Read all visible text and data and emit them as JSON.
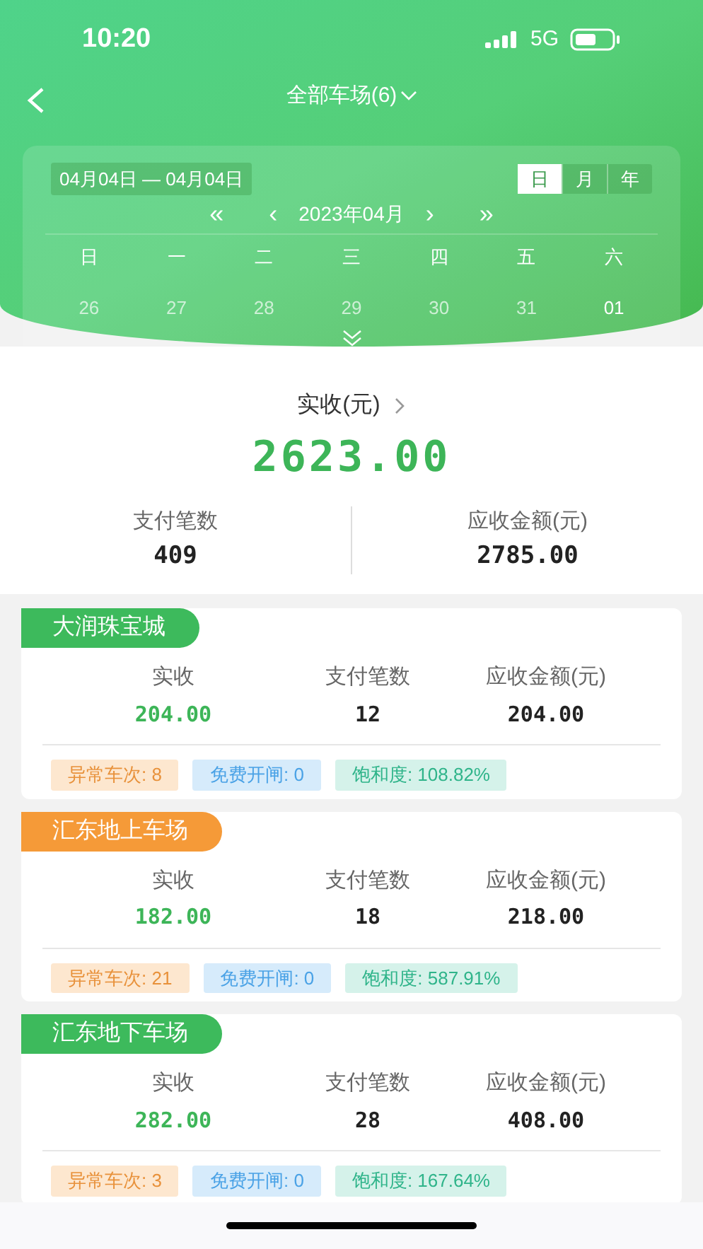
{
  "status_bar": {
    "time": "10:20",
    "network": "5G"
  },
  "nav": {
    "title": "全部车场(6)"
  },
  "calendar": {
    "range": "04月04日 — 04月04日",
    "modes": [
      {
        "label": "日",
        "selected": true
      },
      {
        "label": "月",
        "selected": false
      },
      {
        "label": "年",
        "selected": false
      }
    ],
    "month": "2023年04月",
    "prev_year": "«",
    "prev_month": "‹",
    "next_month": "›",
    "next_year": "»",
    "weekdays": [
      "日",
      "一",
      "二",
      "三",
      "四",
      "五",
      "六"
    ],
    "days": [
      {
        "label": "26",
        "other_month": true
      },
      {
        "label": "27",
        "other_month": true
      },
      {
        "label": "28",
        "other_month": true
      },
      {
        "label": "29",
        "other_month": true
      },
      {
        "label": "30",
        "other_month": true
      },
      {
        "label": "31",
        "other_month": true
      },
      {
        "label": "01",
        "other_month": false
      }
    ]
  },
  "summary": {
    "label": "实收(元)",
    "value": "2623.00",
    "stats": [
      {
        "label": "支付笔数",
        "value": "409"
      },
      {
        "label": "应收金额(元)",
        "value": "2785.00"
      }
    ]
  },
  "lots": [
    {
      "name": "大润珠宝城",
      "color": "#3dba5c",
      "stats": [
        {
          "label": "实收",
          "value": "204.00"
        },
        {
          "label": "支付笔数",
          "value": "12"
        },
        {
          "label": "应收金额(元)",
          "value": "204.00"
        }
      ],
      "tags": [
        {
          "text": "异常车次: 8",
          "kind": "warning"
        },
        {
          "text": "免费开闸: 0",
          "kind": "info"
        },
        {
          "text": "饱和度: 108.82%",
          "kind": "success"
        }
      ]
    },
    {
      "name": "汇东地上车场",
      "color": "#f59a38",
      "stats": [
        {
          "label": "实收",
          "value": "182.00"
        },
        {
          "label": "支付笔数",
          "value": "18"
        },
        {
          "label": "应收金额(元)",
          "value": "218.00"
        }
      ],
      "tags": [
        {
          "text": "异常车次: 21",
          "kind": "warning"
        },
        {
          "text": "免费开闸: 0",
          "kind": "info"
        },
        {
          "text": "饱和度: 587.91%",
          "kind": "success"
        }
      ]
    },
    {
      "name": "汇东地下车场",
      "color": "#3dba5c",
      "stats": [
        {
          "label": "实收",
          "value": "282.00"
        },
        {
          "label": "支付笔数",
          "value": "28"
        },
        {
          "label": "应收金额(元)",
          "value": "408.00"
        }
      ],
      "tags": [
        {
          "text": "异常车次: 3",
          "kind": "warning"
        },
        {
          "text": "免费开闸: 0",
          "kind": "info"
        },
        {
          "text": "饱和度: 167.64%",
          "kind": "success"
        }
      ]
    }
  ]
}
